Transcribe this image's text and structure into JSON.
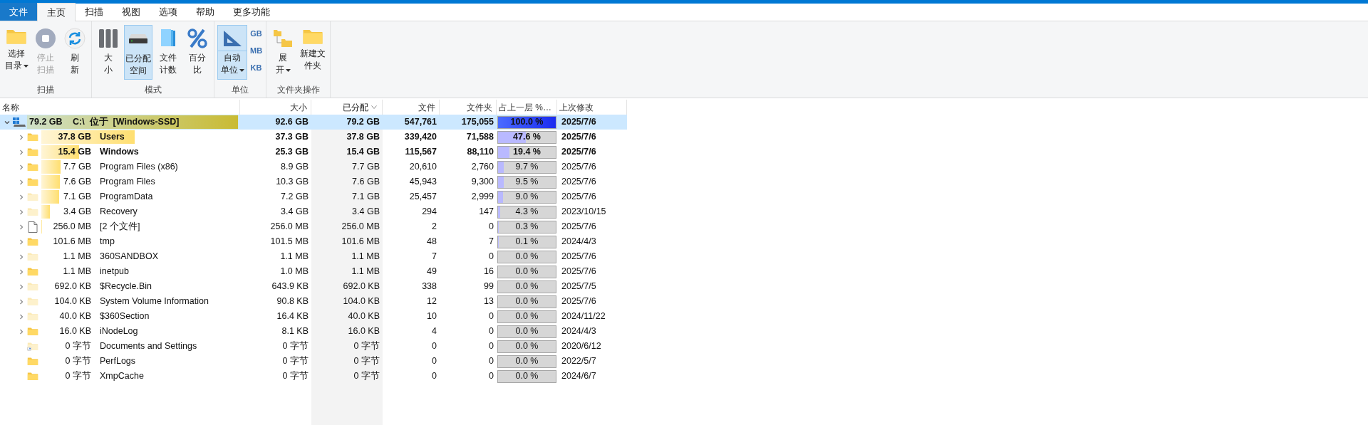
{
  "tabs": [
    {
      "label": "文件",
      "kind": "file",
      "selected": false
    },
    {
      "label": "主页",
      "kind": "tab",
      "selected": true
    },
    {
      "label": "扫描",
      "kind": "tab",
      "selected": false
    },
    {
      "label": "视图",
      "kind": "tab",
      "selected": false
    },
    {
      "label": "选项",
      "kind": "tab",
      "selected": false
    },
    {
      "label": "帮助",
      "kind": "tab",
      "selected": false
    },
    {
      "label": "更多功能",
      "kind": "tab",
      "selected": false
    }
  ],
  "ribbon": [
    {
      "label": "扫描",
      "buttons": [
        {
          "kind": "folder",
          "lines": [
            "选择",
            "目录"
          ],
          "dropdown": true,
          "selected": false,
          "disabled": false
        },
        {
          "kind": "stop",
          "lines": [
            "停止",
            "扫描"
          ],
          "dropdown": false,
          "selected": false,
          "disabled": true
        },
        {
          "kind": "refresh",
          "lines": [
            "刷",
            "新"
          ],
          "dropdown": false,
          "selected": false,
          "disabled": false
        }
      ]
    },
    {
      "label": "模式",
      "buttons": [
        {
          "kind": "bars",
          "lines": [
            "大",
            "小"
          ],
          "dropdown": false,
          "selected": false,
          "disabled": false
        },
        {
          "kind": "drive",
          "lines": [
            "已分配",
            "空间"
          ],
          "dropdown": false,
          "selected": true,
          "disabled": false
        },
        {
          "kind": "files",
          "lines": [
            "文件",
            "计数"
          ],
          "dropdown": false,
          "selected": false,
          "disabled": false
        },
        {
          "kind": "percent",
          "lines": [
            "百分",
            "比"
          ],
          "dropdown": false,
          "selected": false,
          "disabled": false
        }
      ]
    },
    {
      "label": "单位",
      "buttons": [
        {
          "kind": "ruler",
          "lines": [
            "自动",
            "单位"
          ],
          "dropdown": true,
          "selected": true,
          "disabled": false,
          "small": [
            "GB",
            "MB",
            "KB"
          ]
        }
      ]
    },
    {
      "label": "文件夹操作",
      "buttons": [
        {
          "kind": "tree",
          "lines": [
            "展",
            "开"
          ],
          "dropdown": true,
          "selected": false,
          "disabled": false
        },
        {
          "kind": "folder",
          "lines": [
            "新建文",
            "件夹"
          ],
          "dropdown": false,
          "selected": false,
          "disabled": false
        }
      ]
    }
  ],
  "table": {
    "columns": [
      {
        "label": "名称",
        "sorted": false
      },
      {
        "label": "大小",
        "sorted": false
      },
      {
        "label": "已分配",
        "sorted": true
      },
      {
        "label": "文件",
        "sorted": false
      },
      {
        "label": "文件夹",
        "sorted": false
      },
      {
        "label": "占上一层 %…",
        "sorted": false
      },
      {
        "label": "上次修改",
        "sorted": false
      }
    ],
    "root": {
      "allocated": "79.2 GB",
      "name": "C:\\  位于  [Windows-SSD]",
      "size": "92.6 GB",
      "alloc": "79.2 GB",
      "files": "547,761",
      "folders": "175,055",
      "percent": "100.0 %",
      "level": 1,
      "modified": "2025/7/6",
      "kind": "drive",
      "bold": true,
      "selected": true,
      "expanded": true,
      "children": [
        {
          "allocated": "37.8 GB",
          "name": "Users",
          "size": "37.3 GB",
          "alloc": "37.8 GB",
          "files": "339,420",
          "folders": "71,588",
          "percent": "47.6 %",
          "level": 0.476,
          "modified": "2025/7/6",
          "kind": "folder",
          "bold": true,
          "selected": false,
          "expandable": true
        },
        {
          "allocated": "15.4 GB",
          "name": "Windows",
          "size": "25.3 GB",
          "alloc": "15.4 GB",
          "files": "115,567",
          "folders": "88,110",
          "percent": "19.4 %",
          "level": 0.194,
          "modified": "2025/7/6",
          "kind": "folder",
          "bold": true,
          "selected": false,
          "expandable": true
        },
        {
          "allocated": "7.7 GB",
          "name": "Program Files (x86)",
          "size": "8.9 GB",
          "alloc": "7.7 GB",
          "files": "20,610",
          "folders": "2,760",
          "percent": "9.7 %",
          "level": 0.097,
          "modified": "2025/7/6",
          "kind": "folder",
          "bold": false,
          "selected": false,
          "expandable": true
        },
        {
          "allocated": "7.6 GB",
          "name": "Program Files",
          "size": "10.3 GB",
          "alloc": "7.6 GB",
          "files": "45,943",
          "folders": "9,300",
          "percent": "9.5 %",
          "level": 0.095,
          "modified": "2025/7/6",
          "kind": "folder",
          "bold": false,
          "selected": false,
          "expandable": true
        },
        {
          "allocated": "7.1 GB",
          "name": "ProgramData",
          "size": "7.2 GB",
          "alloc": "7.1 GB",
          "files": "25,457",
          "folders": "2,999",
          "percent": "9.0 %",
          "level": 0.09,
          "modified": "2025/7/6",
          "kind": "folder_faded",
          "bold": false,
          "selected": false,
          "expandable": true
        },
        {
          "allocated": "3.4 GB",
          "name": "Recovery",
          "size": "3.4 GB",
          "alloc": "3.4 GB",
          "files": "294",
          "folders": "147",
          "percent": "4.3 %",
          "level": 0.043,
          "modified": "2023/10/15",
          "kind": "folder_faded",
          "bold": false,
          "selected": false,
          "expandable": true
        },
        {
          "allocated": "256.0 MB",
          "name": "[2 个文件]",
          "size": "256.0 MB",
          "alloc": "256.0 MB",
          "files": "2",
          "folders": "0",
          "percent": "0.3 %",
          "level": 0.003,
          "modified": "2025/7/6",
          "kind": "file",
          "bold": false,
          "selected": false,
          "expandable": true
        },
        {
          "allocated": "101.6 MB",
          "name": "tmp",
          "size": "101.5 MB",
          "alloc": "101.6 MB",
          "files": "48",
          "folders": "7",
          "percent": "0.1 %",
          "level": 0.001,
          "modified": "2024/4/3",
          "kind": "folder",
          "bold": false,
          "selected": false,
          "expandable": true
        },
        {
          "allocated": "1.1 MB",
          "name": "360SANDBOX",
          "size": "1.1 MB",
          "alloc": "1.1 MB",
          "files": "7",
          "folders": "0",
          "percent": "0.0 %",
          "level": 0,
          "modified": "2025/7/6",
          "kind": "folder_faded",
          "bold": false,
          "selected": false,
          "expandable": true
        },
        {
          "allocated": "1.1 MB",
          "name": "inetpub",
          "size": "1.0 MB",
          "alloc": "1.1 MB",
          "files": "49",
          "folders": "16",
          "percent": "0.0 %",
          "level": 0,
          "modified": "2025/7/6",
          "kind": "folder",
          "bold": false,
          "selected": false,
          "expandable": true
        },
        {
          "allocated": "692.0 KB",
          "name": "$Recycle.Bin",
          "size": "643.9 KB",
          "alloc": "692.0 KB",
          "files": "338",
          "folders": "99",
          "percent": "0.0 %",
          "level": 0,
          "modified": "2025/7/5",
          "kind": "folder_faded",
          "bold": false,
          "selected": false,
          "expandable": true
        },
        {
          "allocated": "104.0 KB",
          "name": "System Volume Information",
          "size": "90.8 KB",
          "alloc": "104.0 KB",
          "files": "12",
          "folders": "13",
          "percent": "0.0 %",
          "level": 0,
          "modified": "2025/7/6",
          "kind": "folder_faded",
          "bold": false,
          "selected": false,
          "expandable": true
        },
        {
          "allocated": "40.0 KB",
          "name": "$360Section",
          "size": "16.4 KB",
          "alloc": "40.0 KB",
          "files": "10",
          "folders": "0",
          "percent": "0.0 %",
          "level": 0,
          "modified": "2024/11/22",
          "kind": "folder_faded",
          "bold": false,
          "selected": false,
          "expandable": true
        },
        {
          "allocated": "16.0 KB",
          "name": "iNodeLog",
          "size": "8.1 KB",
          "alloc": "16.0 KB",
          "files": "4",
          "folders": "0",
          "percent": "0.0 %",
          "level": 0,
          "modified": "2024/4/3",
          "kind": "folder",
          "bold": false,
          "selected": false,
          "expandable": true
        },
        {
          "allocated": "0 字节",
          "name": "Documents and Settings",
          "size": "0 字节",
          "alloc": "0 字节",
          "files": "0",
          "folders": "0",
          "percent": "0.0 %",
          "level": 0,
          "modified": "2020/6/12",
          "kind": "shortcut",
          "bold": false,
          "selected": false,
          "expandable": false
        },
        {
          "allocated": "0 字节",
          "name": "PerfLogs",
          "size": "0 字节",
          "alloc": "0 字节",
          "files": "0",
          "folders": "0",
          "percent": "0.0 %",
          "level": 0,
          "modified": "2022/5/7",
          "kind": "folder",
          "bold": false,
          "selected": false,
          "expandable": false
        },
        {
          "allocated": "0 字节",
          "name": "XmpCache",
          "size": "0 字节",
          "alloc": "0 字节",
          "files": "0",
          "folders": "0",
          "percent": "0.0 %",
          "level": 0,
          "modified": "2024/6/7",
          "kind": "folder",
          "bold": false,
          "selected": false,
          "expandable": false
        }
      ]
    }
  }
}
